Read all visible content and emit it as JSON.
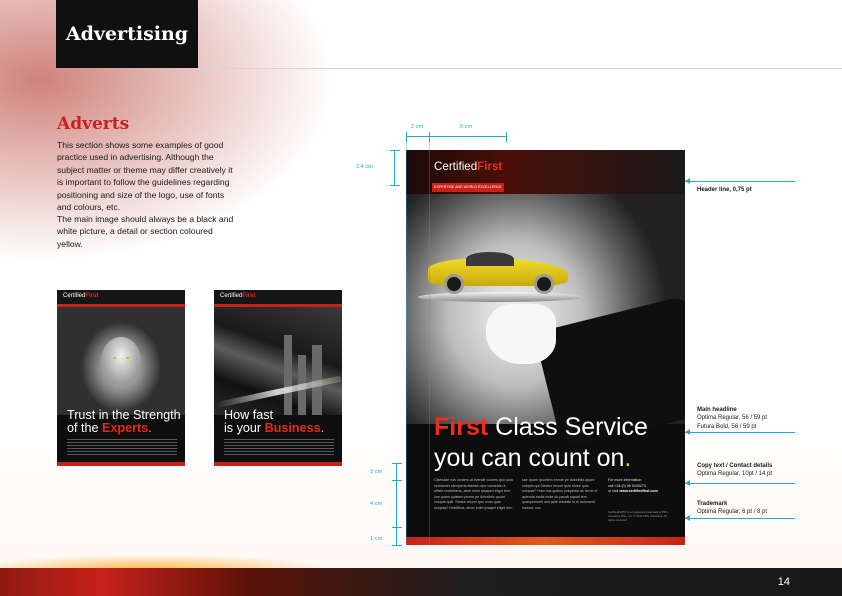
{
  "header": {
    "title": "Advertising"
  },
  "section": {
    "title": "Adverts",
    "paragraphs": [
      "This section shows some examples of good practice used in advertising. Although the subject matter or theme may differ creatively it is important to follow the guidelines regarding positioning and size of the logo, use of fonts and colours, etc.",
      "The main image should always be a black and white picture, a detail or section coloured yellow."
    ]
  },
  "small_adverts": [
    {
      "logo_main": "Certified",
      "logo_accent": "First",
      "headline_line1": "Trust in the Strength",
      "headline_line2_prefix": "of the ",
      "headline_accent": "Experts",
      "headline_dot": "."
    },
    {
      "logo_main": "Certified",
      "logo_accent": "First",
      "headline_line1": "How fast",
      "headline_line2_prefix": "is your ",
      "headline_accent": "Business",
      "headline_dot": "."
    }
  ],
  "large_advert": {
    "logo_main": "Certified",
    "logo_accent": "First",
    "tagline": "EXPERTISE AND WORLD EXCELLENCE",
    "headline_accent": "First",
    "headline_rest": " Class Service",
    "headline_line2": "you can count on",
    "headline_dot": ".",
    "copy_col1": "Claesdae nos contem at evendit volores quo quia vendamer siemperia aladam que consedis ut officie molebfacis, ation enim ipsaped eligni tem ium quam quistem piume pe doloribtio quunt volupta quiti. Seatur recum quo moto quia volupsa? Debitibus, aborr enim ipsapel eligni tem",
    "copy_col2": "sae quam quuntem ervnte pe doloribtia quunt volupta qui Steatur recum quia molur quia volupsa? Haw nos quibus volupitasi as tia nit et apienda nadis mote do pacab squati tem quaspernmet alut aute volotate in el doloruent incessi, sus",
    "contact_label": "For more information",
    "contact_phone": "call +34 (0) 96 5430273",
    "contact_web_prefix": "or visit ",
    "contact_web": "www.certifiedfirst.com",
    "trademark": "CertifiedFIRST is a registered trademark of PPG Industries Ohio, Inc. © 2011 PPG Industries. All rights reserved."
  },
  "dimensions": {
    "top_left": "2 cm",
    "top_right": "5 cm",
    "header_height": "2,4 cm",
    "side_1": "3 cm",
    "side_2": "4 cm",
    "side_3": "1 cm"
  },
  "specs": [
    {
      "title": "Header line, 0,75 pt",
      "lines": []
    },
    {
      "title": "Main headline",
      "lines": [
        "Optima Regular, 56 / 59 pt",
        "Futura Bold, 56 / 59 pt"
      ]
    },
    {
      "title": "Copy text / Contact details",
      "lines": [
        "Optima Regular, 10pt / 14 pt"
      ]
    },
    {
      "title": "Trademark",
      "lines": [
        "Optima Regular, 6  pt / 8 pt"
      ]
    }
  ],
  "footer": {
    "page_number": "14"
  },
  "colors": {
    "brand_red": "#c8211a",
    "accent_yellow": "#f3c81a",
    "annotation_blue": "#29a8d4",
    "header_black": "#101010"
  }
}
